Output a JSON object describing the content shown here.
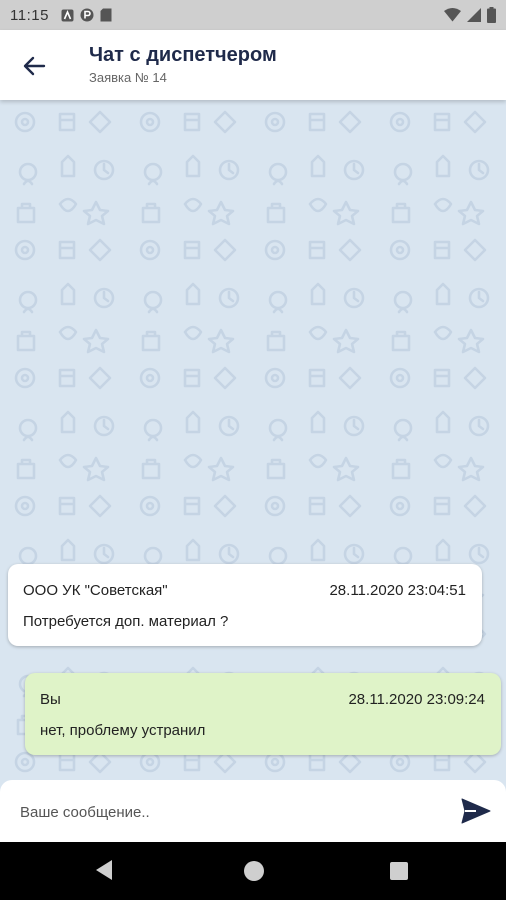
{
  "status_bar": {
    "time": "11:15"
  },
  "header": {
    "title": "Чат с диспетчером",
    "subtitle": "Заявка № 14"
  },
  "messages": [
    {
      "sender": "ООО УК \"Советская\"",
      "time": "28.11.2020 23:04:51",
      "text": "Потребуется доп. материал ?",
      "direction": "incoming"
    },
    {
      "sender": "Вы",
      "time": "28.11.2020 23:09:24",
      "text": "нет, проблему устранил",
      "direction": "outgoing"
    }
  ],
  "composer": {
    "placeholder": "Ваше сообщение..",
    "value": ""
  },
  "colors": {
    "chat_bg": "#d9e5f0",
    "incoming_bubble": "#ffffff",
    "outgoing_bubble": "#dff3c8",
    "accent": "#1f2a4a"
  }
}
